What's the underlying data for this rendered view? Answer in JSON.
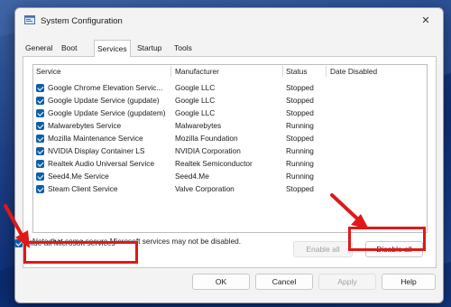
{
  "window": {
    "title": "System Configuration",
    "close_glyph": "✕"
  },
  "tabs": [
    {
      "label": "General"
    },
    {
      "label": "Boot"
    },
    {
      "label": "Services",
      "active": true
    },
    {
      "label": "Startup"
    },
    {
      "label": "Tools"
    }
  ],
  "table": {
    "headers": [
      "Service",
      "Manufacturer",
      "Status",
      "Date Disabled"
    ],
    "rows": [
      {
        "checked": true,
        "service": "Google Chrome Elevation Servic...",
        "manufacturer": "Google LLC",
        "status": "Stopped",
        "date_disabled": ""
      },
      {
        "checked": true,
        "service": "Google Update Service (gupdate)",
        "manufacturer": "Google LLC",
        "status": "Stopped",
        "date_disabled": ""
      },
      {
        "checked": true,
        "service": "Google Update Service (gupdatem)",
        "manufacturer": "Google LLC",
        "status": "Stopped",
        "date_disabled": ""
      },
      {
        "checked": true,
        "service": "Malwarebytes Service",
        "manufacturer": "Malwarebytes",
        "status": "Running",
        "date_disabled": ""
      },
      {
        "checked": true,
        "service": "Mozilla Maintenance Service",
        "manufacturer": "Mozilla Foundation",
        "status": "Stopped",
        "date_disabled": ""
      },
      {
        "checked": true,
        "service": "NVIDIA Display Container LS",
        "manufacturer": "NVIDIA Corporation",
        "status": "Running",
        "date_disabled": ""
      },
      {
        "checked": true,
        "service": "Realtek Audio Universal Service",
        "manufacturer": "Realtek Semiconductor",
        "status": "Running",
        "date_disabled": ""
      },
      {
        "checked": true,
        "service": "Seed4.Me Service",
        "manufacturer": "Seed4.Me",
        "status": "Running",
        "date_disabled": ""
      },
      {
        "checked": true,
        "service": "Steam Client Service",
        "manufacturer": "Valve Corporation",
        "status": "Stopped",
        "date_disabled": ""
      }
    ]
  },
  "note": "Note that some secure Microsoft services may not be disabled.",
  "enable_all_label": "Enable all",
  "disable_all_label": "Disable all",
  "hide_microsoft": {
    "label": "Hide all Microsoft services",
    "checked": true
  },
  "footer": {
    "ok": "OK",
    "cancel": "Cancel",
    "apply": "Apply",
    "help": "Help"
  },
  "colors": {
    "highlight_red": "#e01818",
    "checkbox_blue": "#0c5fa8"
  }
}
